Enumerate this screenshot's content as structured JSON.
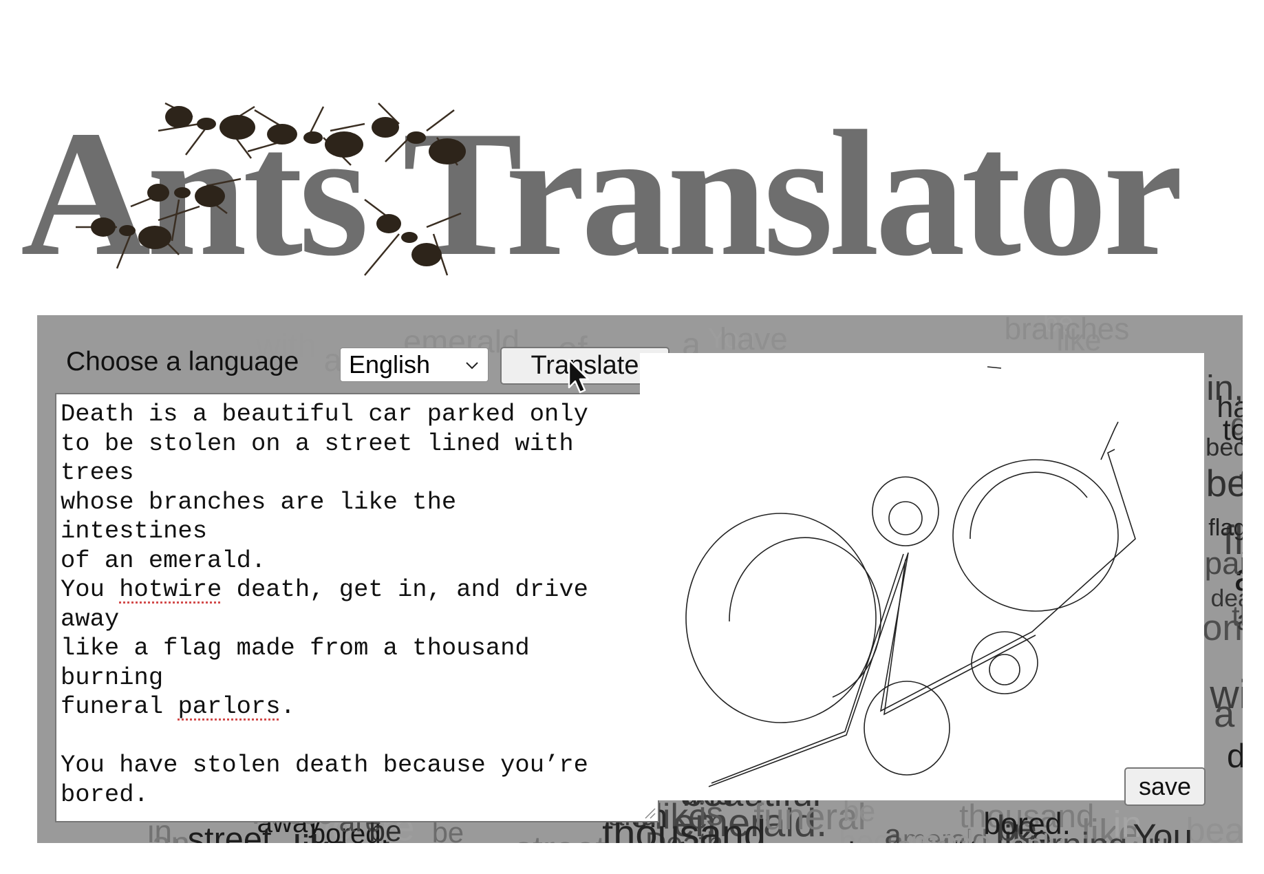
{
  "header": {
    "title": "Ants Translator",
    "logo_icon": "ants-illustration"
  },
  "controls": {
    "language_label": "Choose a language",
    "language_selected": "English",
    "translate_label": "Translate",
    "save_label": "save"
  },
  "poem": {
    "lines": [
      "Death is a beautiful car parked only",
      "to be stolen on a street lined with",
      "trees",
      "whose branches are like the",
      "intestines",
      "of an emerald.",
      "You hotwire death, get in, and drive",
      "away",
      "like a flag made from a thousand",
      "burning",
      "funeral parlors.",
      "",
      "You have stolen death because you’re",
      "bored."
    ],
    "misspelled": [
      "hotwire",
      "parlors"
    ]
  },
  "colors": {
    "title": "#6e6e6e",
    "panel_bg": "#9a9a9a",
    "spell_underline": "#d24a4a"
  },
  "icons": {
    "cursor": "mouse-pointer-icon",
    "select_arrow": "chevron-down-icon",
    "resize": "resize-grip-icon"
  }
}
